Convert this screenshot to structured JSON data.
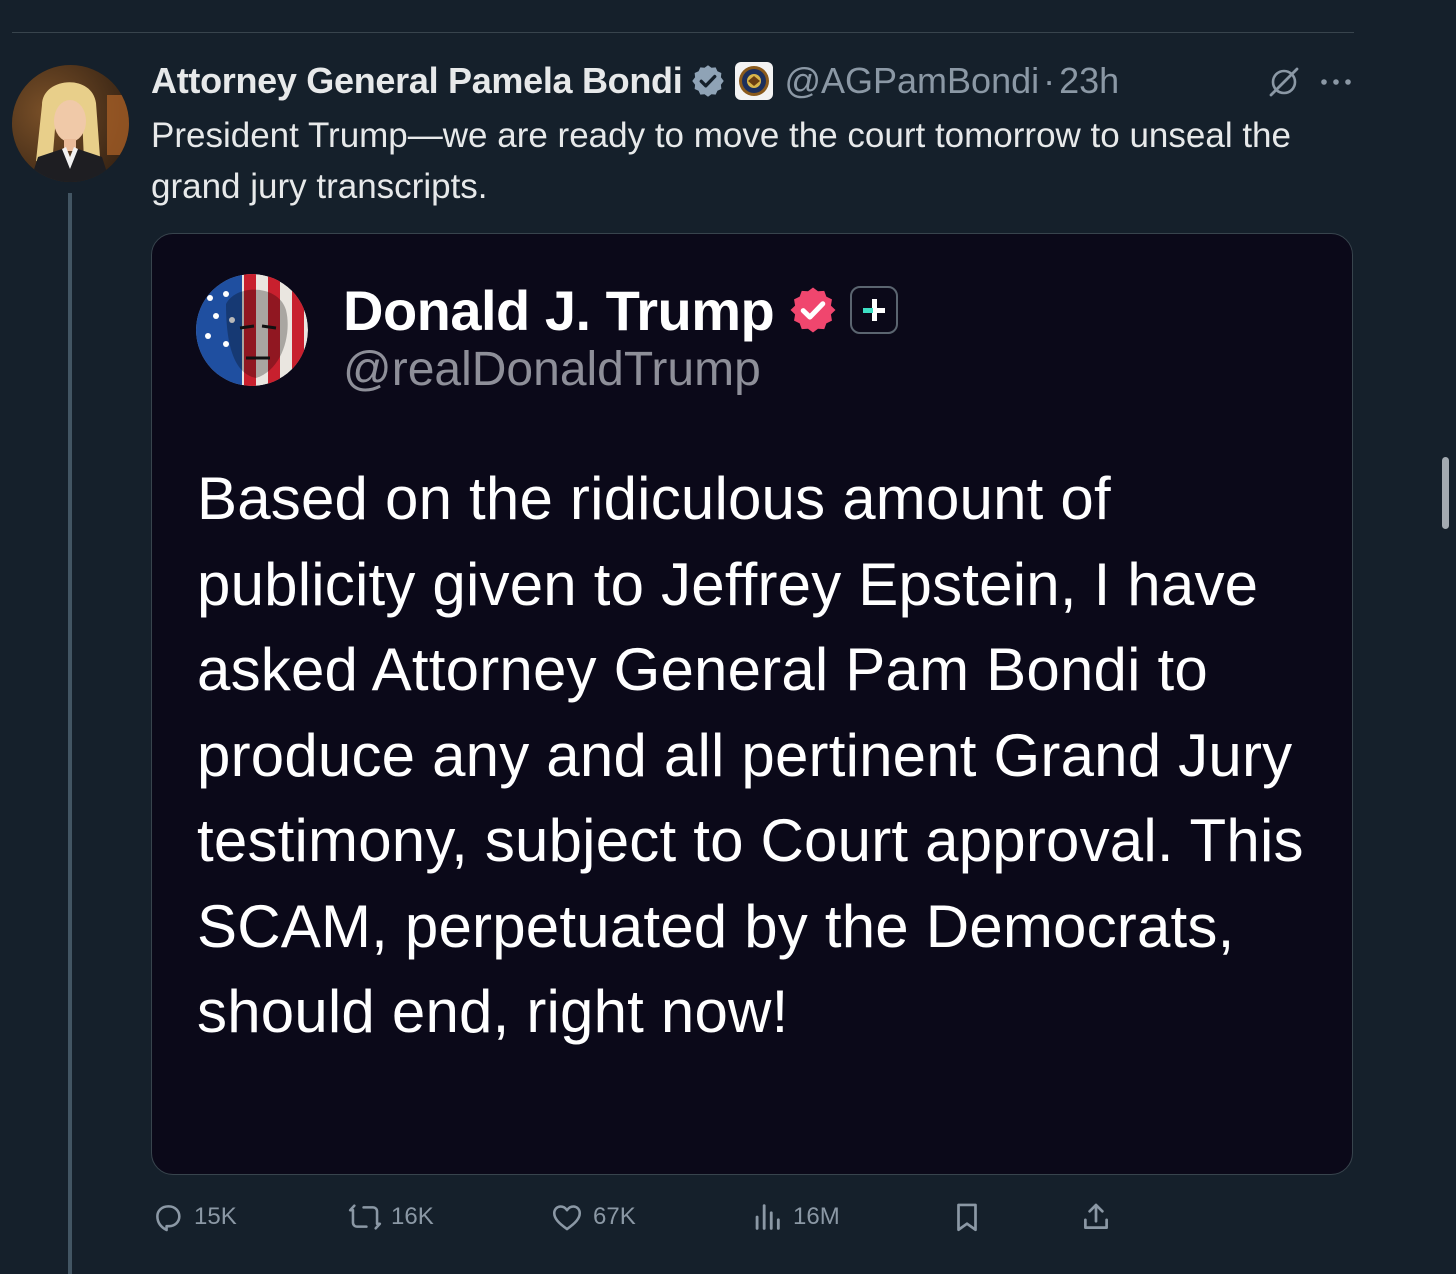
{
  "tweet": {
    "author_name": "Attorney General Pamela Bondi",
    "handle": "@AGPamBondi",
    "separator": "·",
    "time": "23h",
    "text": "President Trump—we are ready to move the court tomorrow to unseal the grand jury transcripts."
  },
  "quoted": {
    "author_name": "Donald J. Trump",
    "handle": "@realDonaldTrump",
    "text": "Based on the ridiculous amount of publicity given to Jeffrey Epstein, I have asked Attorney General Pam Bondi to produce any and all pertinent Grand Jury testimony, subject to Court approval. This SCAM, perpetuated by the Democrats, should end, right now!"
  },
  "actions": {
    "replies": "15K",
    "reposts": "16K",
    "likes": "67K",
    "views": "16M"
  },
  "icons": {
    "verified": "verified-badge-icon",
    "affiliate": "doj-seal-icon",
    "grok": "grok-icon",
    "more": "more-icon",
    "reply": "reply-icon",
    "repost": "repost-icon",
    "like": "heart-icon",
    "views": "views-icon",
    "bookmark": "bookmark-icon",
    "share": "share-icon"
  },
  "colors": {
    "background": "#15202b",
    "secondary_text": "#8b98a5",
    "quote_background": "#0b0919",
    "truth_verified": "#f0466e",
    "verified_blue": "#8fa3b6"
  }
}
